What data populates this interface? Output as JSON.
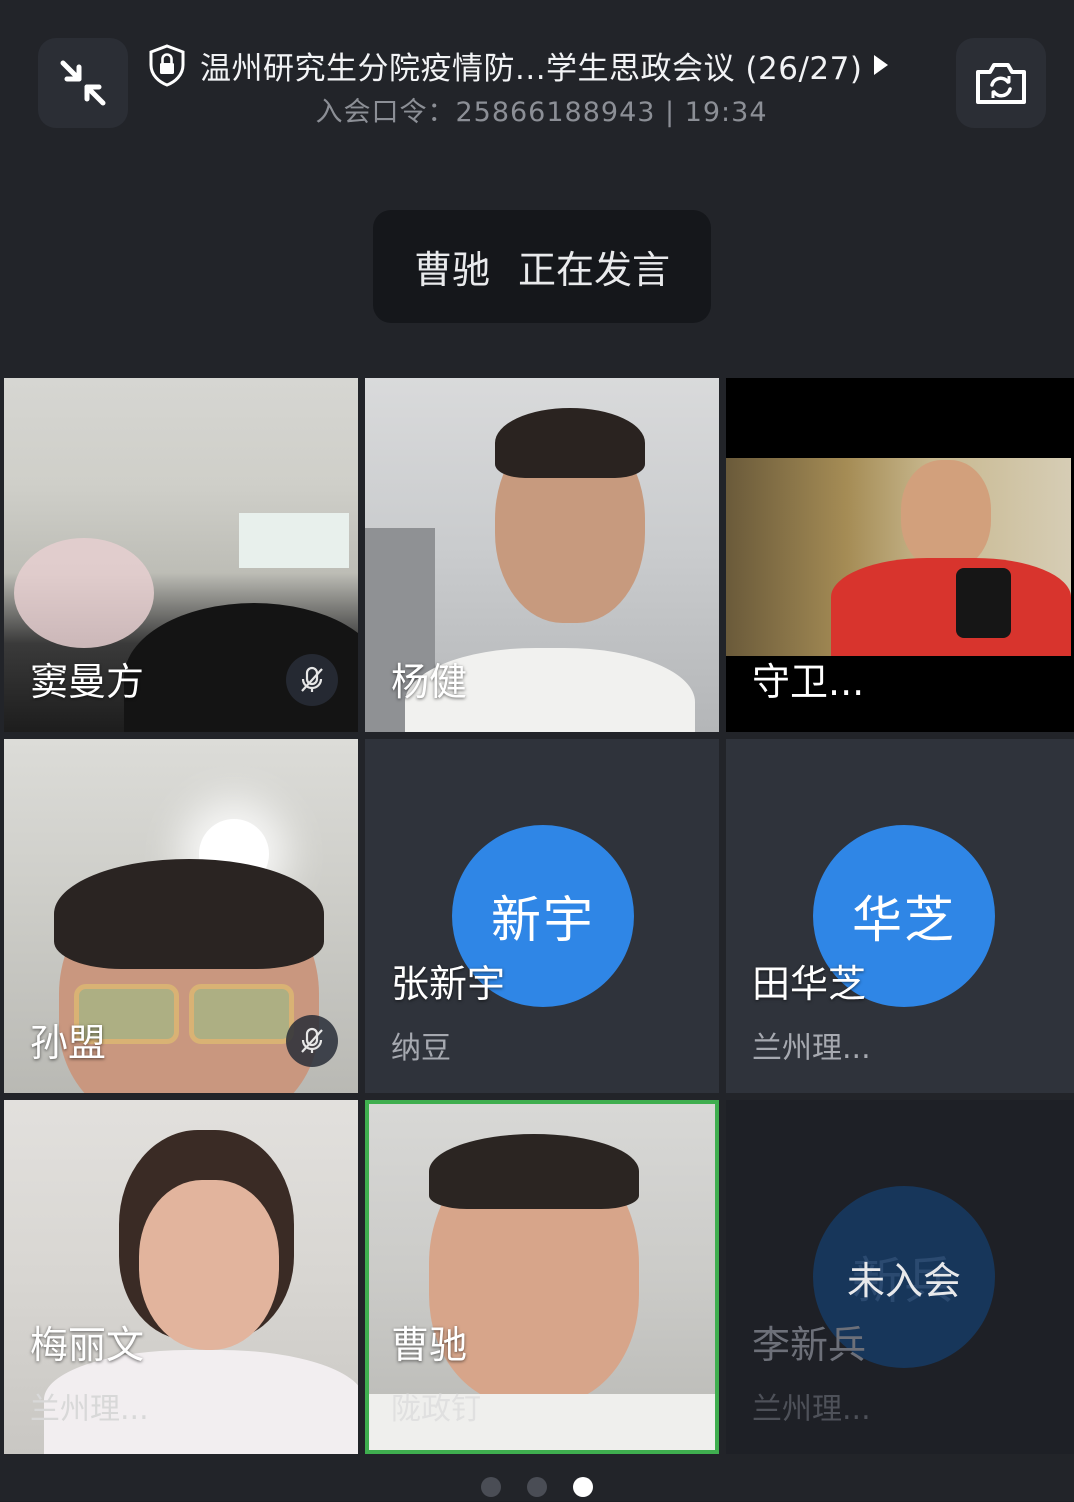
{
  "header": {
    "title": "温州研究生分院疫情防...学生思政会议 (26/27)",
    "subtitle": "入会口令：25866188943 | 19:34",
    "collapse_icon": "collapse-arrows-icon",
    "camera_switch_icon": "camera-switch-icon",
    "lock_icon": "shield-lock-icon"
  },
  "speaking": {
    "name": "曹驰",
    "status": "正在发言"
  },
  "participants": [
    {
      "name": "窦曼方",
      "muted": true,
      "type": "video"
    },
    {
      "name": "杨健",
      "muted": false,
      "type": "video"
    },
    {
      "name": "守卫...",
      "muted": false,
      "type": "video"
    },
    {
      "name": "孙盟",
      "muted": true,
      "type": "video"
    },
    {
      "name": "张新宇",
      "avatar": "新宇",
      "sub": "纳豆",
      "type": "avatar"
    },
    {
      "name": "田华芝",
      "avatar": "华芝",
      "sub": "兰州理...",
      "type": "avatar"
    },
    {
      "name": "梅丽文",
      "sub": "兰州理...",
      "type": "video"
    },
    {
      "name": "曹驰",
      "sub": "陇政钉",
      "type": "video",
      "speaking": true
    },
    {
      "name": "李新兵",
      "avatar": "新兵",
      "sub": "兰州理...",
      "status": "未入会",
      "type": "not-joined"
    }
  ],
  "pagination": {
    "pages": 3,
    "current": 3
  },
  "colors": {
    "background": "#222429",
    "avatar_blue": "#2f86e6",
    "speaking_border": "#3fae4f",
    "mute_icon": "mic-off-icon"
  }
}
